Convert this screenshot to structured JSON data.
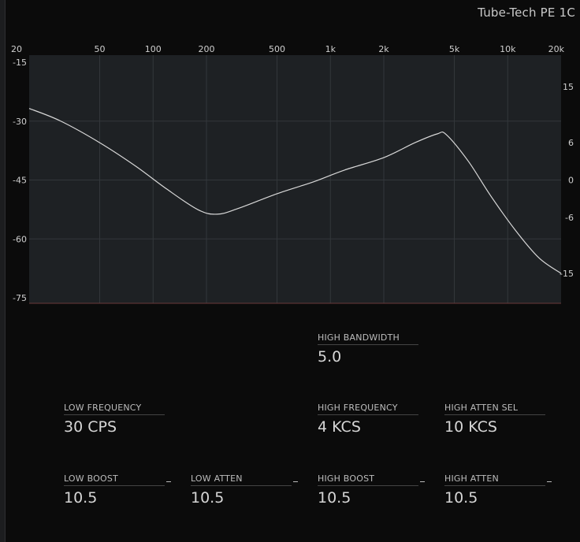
{
  "app": {
    "title": "Tube-Tech PE 1C"
  },
  "graph": {
    "x_ticks": [
      "20",
      "50",
      "100",
      "200",
      "500",
      "1k",
      "2k",
      "5k",
      "10k",
      "20k"
    ],
    "x_tick_values": [
      20,
      50,
      100,
      200,
      500,
      1000,
      2000,
      5000,
      10000,
      20000
    ],
    "left_ticks": [
      "-15",
      "-30",
      "-45",
      "-60",
      "-75"
    ],
    "left_tick_values": [
      -15,
      -30,
      -45,
      -60,
      -75
    ],
    "right_ticks": [
      "15",
      "6",
      "0",
      "-6",
      "-15"
    ],
    "right_tick_values": [
      15,
      6,
      0,
      -6,
      -15
    ],
    "colors": {
      "plot_bg": "#1e2124",
      "grid": "#33373b",
      "curve": "#d8d8d8",
      "baseline": "#6b3a3a"
    }
  },
  "curve_data": {
    "x_scale": "log",
    "x_range_hz": [
      20,
      20000
    ],
    "y_range_db": [
      -18,
      18
    ],
    "points": [
      [
        20,
        11.5
      ],
      [
        30,
        9.5
      ],
      [
        50,
        6.0
      ],
      [
        80,
        2.2
      ],
      [
        120,
        -1.5
      ],
      [
        180,
        -4.8
      ],
      [
        230,
        -5.5
      ],
      [
        300,
        -4.6
      ],
      [
        500,
        -2.2
      ],
      [
        800,
        -0.3
      ],
      [
        1200,
        1.6
      ],
      [
        2000,
        3.6
      ],
      [
        3000,
        6.0
      ],
      [
        4000,
        7.4
      ],
      [
        4500,
        7.3
      ],
      [
        6000,
        3.0
      ],
      [
        8000,
        -2.5
      ],
      [
        11000,
        -8.0
      ],
      [
        15000,
        -12.5
      ],
      [
        20000,
        -15.0
      ]
    ]
  },
  "params": {
    "high_bandwidth": {
      "label": "HIGH BANDWIDTH",
      "value": "5.0"
    },
    "low_frequency": {
      "label": "LOW FREQUENCY",
      "value": "30 CPS"
    },
    "high_frequency": {
      "label": "HIGH FREQUENCY",
      "value": "4 KCS"
    },
    "high_atten_sel": {
      "label": "HIGH ATTEN SEL",
      "value": "10 KCS"
    },
    "low_boost": {
      "label": "LOW BOOST",
      "value": "10.5"
    },
    "low_atten": {
      "label": "LOW ATTEN",
      "value": "10.5"
    },
    "high_boost": {
      "label": "HIGH BOOST",
      "value": "10.5"
    },
    "high_atten": {
      "label": "HIGH ATTEN",
      "value": "10.5"
    }
  }
}
